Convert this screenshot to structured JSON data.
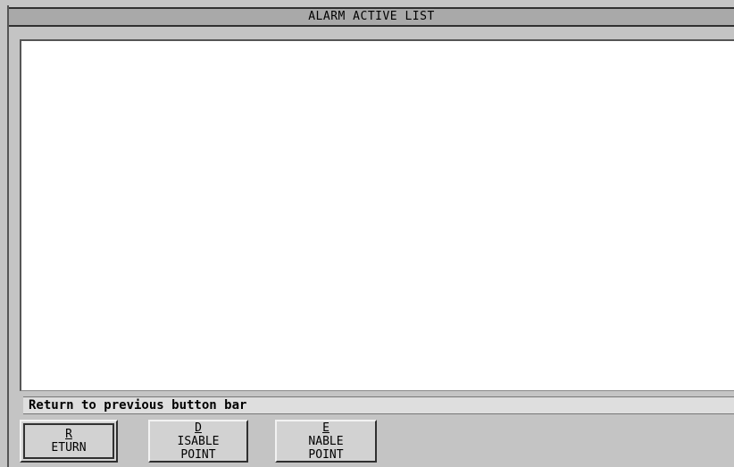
{
  "window": {
    "title": "ALARM ACTIVE LIST"
  },
  "alarm_list": {
    "items": []
  },
  "status_bar": {
    "text": "Return to previous button bar"
  },
  "buttons": {
    "return": {
      "mnemonic": "R",
      "rest": "ETURN"
    },
    "disable_point": {
      "line1_mnemonic": "D",
      "line1_rest": "ISABLE",
      "line2": "POINT"
    },
    "enable_point": {
      "line1_mnemonic": "E",
      "line1_rest": "NABLE",
      "line2": "POINT"
    }
  }
}
